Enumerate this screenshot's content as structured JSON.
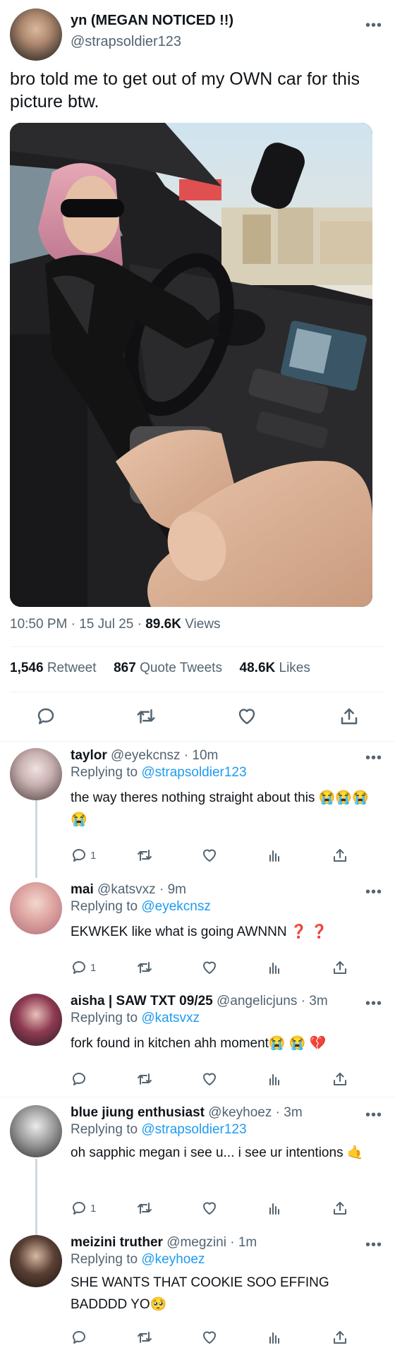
{
  "tweet": {
    "display_name": "yn (MEGAN NOTICED !!)",
    "handle": "@strapsoldier123",
    "text": "bro told me to get out of my OWN car for this picture btw.",
    "meta_prefix": "10:50 PM · 15 Jul 25 · ",
    "views_count": "89.6K",
    "views_label": " Views",
    "stats": {
      "retweets_count": "1,546",
      "retweets_label": "Retweet",
      "quotes_count": "867",
      "quotes_label": "Quote Tweets",
      "likes_count": "48.6K",
      "likes_label": "Likes"
    },
    "more_icon": "more-horizontal-icon"
  },
  "actions": [
    "reply-icon",
    "retweet-icon",
    "like-icon",
    "share-icon"
  ],
  "replying_label": "Replying to ",
  "replies": [
    {
      "name": "taylor",
      "handle": "@eyekcnsz",
      "time": "10m",
      "replying_to": "@strapsoldier123",
      "text": "the way theres nothing straight about this 😭😭😭😭",
      "reply_count": "1"
    },
    {
      "name": "mai",
      "handle": "@katsvxz",
      "time": "9m",
      "replying_to": "@eyekcnsz",
      "text": "EKWKEK like what is going AWNNN ❓ ❓",
      "reply_count": "1"
    },
    {
      "name": "aisha | SAW TXT 09/25",
      "handle": "@angelicjuns",
      "time": "3m",
      "replying_to": "@katsvxz",
      "text": "fork found in kitchen ahh moment😭 😭 💔",
      "reply_count": ""
    },
    {
      "name": "blue jiung enthusiast",
      "handle": "@keyhoez",
      "time": "3m",
      "replying_to": "@strapsoldier123",
      "text": "oh sapphic megan i see u... i see ur intentions 🤙",
      "reply_count": "1"
    },
    {
      "name": "meizini truther",
      "handle": "@megzini",
      "time": "1m",
      "replying_to": "@keyhoez",
      "text": "SHE WANTS THAT COOKIE SOO EFFING BADDDD YO🥺",
      "reply_count": ""
    }
  ]
}
